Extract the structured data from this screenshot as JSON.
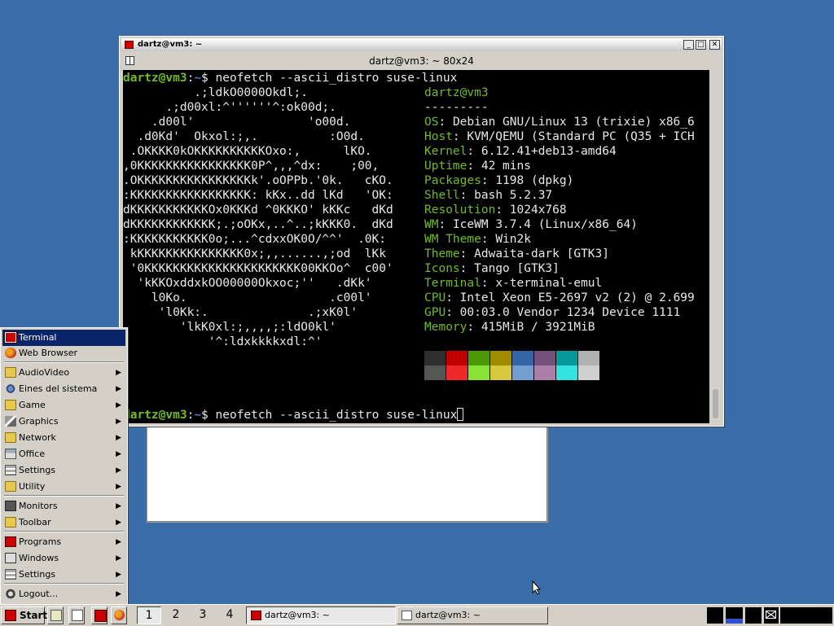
{
  "terminal_window": {
    "title": "dartz@vm3: ~",
    "menu_title": "dartz@vm3: ~ 80x24",
    "buttons": {
      "minimize": "_",
      "maximize": "□",
      "close": "✕"
    }
  },
  "terminal": {
    "prompt_user": "dartz@vm3",
    "prompt_sep": ":",
    "prompt_path": "~",
    "prompt_suffix": "$ ",
    "command": "neofetch --ascii_distro suse-linux",
    "ascii_art": [
      "          .;ldkO0000Okdl;.",
      "      .;d00xl:^''''''^:ok00d;.",
      "    .d00l'                'o00d.",
      "  .d0Kd'  Okxol:;,.          :O0d.",
      " .OKKKK0kOKKKKKKKKKKOxo:,      lKO.",
      ",0KKKKKKKKKKKKKKKK0P^,,,^dx:    ;00,",
      ".OKKKKKKKKKKKKKKKKk'.oOPPb.'0k.   cKO.",
      ":KKKKKKKKKKKKKKKKK: kKx..dd lKd   'OK:",
      "dKKKKKKKKKKKOx0KKKd ^0KKKO' kKKc   dKd",
      "dKKKKKKKKKKKK;.;oOKx,..^..;kKKK0.  dKd",
      ":KKKKKKKKKKK0o;...^cdxxOK0O/^^'  .0K:",
      " kKKKKKKKKKKKKKKK0x;,,......,;od  lKk",
      " '0KKKKKKKKKKKKKKKKKKKKKK00KKOo^  c00'",
      "  'kKKOxddxkOO00000Okxoc;''   .dKk'",
      "    l0Ko.                    .c00l'",
      "     'l0Kk:.              .;xK0l'",
      "        'lkK0xl:;,,,,;:ldO0kl'",
      "            '^:ldxkkkkxdl:^'"
    ],
    "info_user": "dartz@vm3",
    "info_separator": "---------",
    "info": [
      {
        "key": "OS",
        "value": "Debian GNU/Linux 13 (trixie) x86_6"
      },
      {
        "key": "Host",
        "value": "KVM/QEMU (Standard PC (Q35 + ICH"
      },
      {
        "key": "Kernel",
        "value": "6.12.41+deb13-amd64"
      },
      {
        "key": "Uptime",
        "value": "42 mins"
      },
      {
        "key": "Packages",
        "value": "1198 (dpkg)"
      },
      {
        "key": "Shell",
        "value": "bash 5.2.37"
      },
      {
        "key": "Resolution",
        "value": "1024x768"
      },
      {
        "key": "WM",
        "value": "IceWM 3.7.4 (Linux/x86_64)"
      },
      {
        "key": "WM Theme",
        "value": "Win2k"
      },
      {
        "key": "Theme",
        "value": "Adwaita-dark [GTK3]"
      },
      {
        "key": "Icons",
        "value": "Tango [GTK3]"
      },
      {
        "key": "Terminal",
        "value": "x-terminal-emul"
      },
      {
        "key": "CPU",
        "value": "Intel Xeon E5-2697 v2 (2) @ 2.699"
      },
      {
        "key": "GPU",
        "value": "00:03.0 Vendor 1234 Device 1111"
      },
      {
        "key": "Memory",
        "value": "415MiB / 3921MiB"
      }
    ],
    "palette_top": [
      "#2e2e2e",
      "#c00000",
      "#4e9a06",
      "#a08a00",
      "#3465a4",
      "#75507b",
      "#06989a",
      "#b0b0b0"
    ],
    "palette_bottom": [
      "#555753",
      "#ef2929",
      "#8ae234",
      "#d8c840",
      "#729fcf",
      "#ad7fa8",
      "#34e2e2",
      "#d0d0d0"
    ]
  },
  "start_menu": {
    "items": [
      {
        "label": "Terminal",
        "icon": "terminal-icon",
        "submenu": false,
        "selected": true
      },
      {
        "label": "Web Browser",
        "icon": "web-browser-icon",
        "submenu": false
      },
      {
        "label": "AudioVideo",
        "icon": "folder-icon",
        "submenu": true
      },
      {
        "label": "Eines del sistema",
        "icon": "system-tools-icon",
        "submenu": true
      },
      {
        "label": "Game",
        "icon": "folder-icon",
        "submenu": true
      },
      {
        "label": "Graphics",
        "icon": "graphics-icon",
        "submenu": true
      },
      {
        "label": "Network",
        "icon": "folder-icon",
        "submenu": true
      },
      {
        "label": "Office",
        "icon": "office-icon",
        "submenu": true
      },
      {
        "label": "Settings",
        "icon": "settings-icon",
        "submenu": true
      },
      {
        "label": "Utility",
        "icon": "folder-icon",
        "submenu": true
      },
      {
        "label": "Monitors",
        "icon": "monitor-icon",
        "submenu": true
      },
      {
        "label": "Toolbar",
        "icon": "folder-icon",
        "submenu": true
      },
      {
        "label": "Programs",
        "icon": "programs-icon",
        "submenu": true
      },
      {
        "label": "Windows",
        "icon": "windows-icon",
        "submenu": true
      },
      {
        "label": "Settings",
        "icon": "settings-icon",
        "submenu": true
      },
      {
        "label": "Logout...",
        "icon": "logout-icon",
        "submenu": true
      }
    ],
    "arrow": "▶"
  },
  "taskbar": {
    "start_label": "Start",
    "workspaces": [
      "1",
      "2",
      "3",
      "4"
    ],
    "active_workspace": "1",
    "tasks": [
      {
        "label": "dartz@vm3: ~",
        "icon": "terminal-icon",
        "active": true
      },
      {
        "label": "dartz@vm3: ~",
        "icon": "window-icon",
        "active": false
      }
    ]
  },
  "colors": {
    "desktop": "#3b6ea8",
    "terminal_green": "#73ba25",
    "selection": "#0a246a"
  }
}
